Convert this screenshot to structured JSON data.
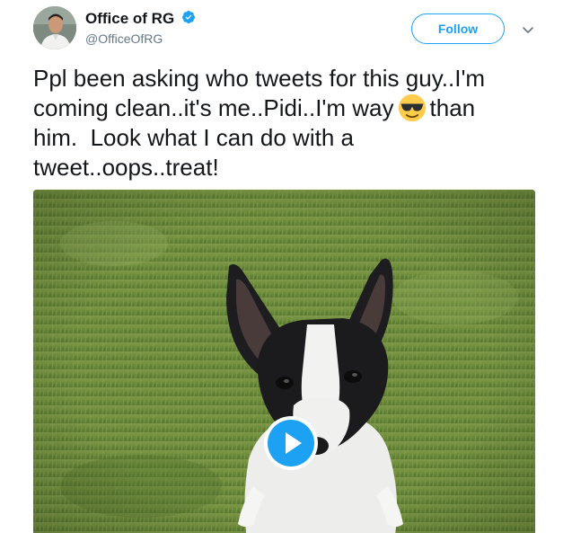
{
  "tweet": {
    "author": {
      "name": "Office of RG",
      "handle": "@OfficeOfRG",
      "verified": true,
      "avatar_icon": "profile-photo"
    },
    "follow_label": "Follow",
    "more_icon": "chevron-down-icon",
    "text_lines": [
      {
        "before": "Ppl been asking who tweets for this guy..I'm"
      },
      {
        "before": "coming clean..it's me..Pidi..I'm way",
        "emoji": "smiling-face-with-sunglasses",
        "after": "than"
      },
      {
        "before": "him.  Look what I can do with a"
      },
      {
        "before": "tweet..oops..treat!"
      }
    ],
    "media": {
      "type": "video",
      "play_icon": "play-icon"
    }
  },
  "colors": {
    "accent": "#1da1f2",
    "text": "#14171a",
    "secondary_text": "#657786",
    "grass": "#6f8f3f"
  }
}
